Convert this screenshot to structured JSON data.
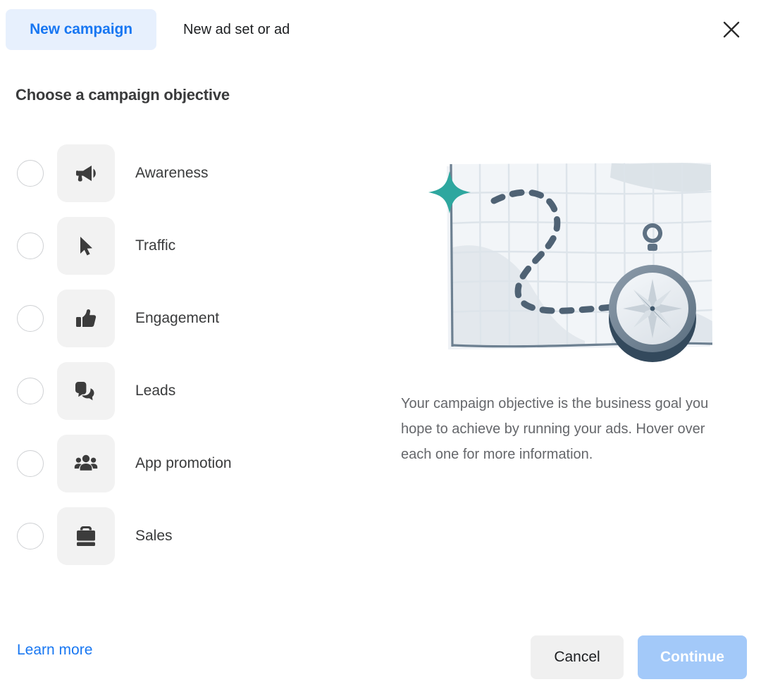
{
  "header": {
    "tabs": [
      {
        "label": "New campaign",
        "active": true,
        "name": "tab-new-campaign"
      },
      {
        "label": "New ad set or ad",
        "active": false,
        "name": "tab-new-ad-set-or-ad"
      }
    ],
    "close_icon": "close-icon",
    "accent_color": "#1877f2",
    "active_tab_bg": "#e7f0fd"
  },
  "main": {
    "section_title": "Choose a campaign objective",
    "objectives": [
      {
        "label": "Awareness",
        "icon": "megaphone-icon",
        "selected": false
      },
      {
        "label": "Traffic",
        "icon": "cursor-icon",
        "selected": false
      },
      {
        "label": "Engagement",
        "icon": "thumbs-up-icon",
        "selected": false
      },
      {
        "label": "Leads",
        "icon": "chat-bubbles-icon",
        "selected": false
      },
      {
        "label": "App promotion",
        "icon": "people-group-icon",
        "selected": false
      },
      {
        "label": "Sales",
        "icon": "briefcase-icon",
        "selected": false
      }
    ]
  },
  "info_panel": {
    "illustration_name": "map-with-compass-illustration",
    "star_color": "#2ea79f",
    "path_color": "#4f6274",
    "description": "Your campaign objective is the business goal you hope to achieve by running your ads. Hover over each one for more information."
  },
  "footer": {
    "learn_more_label": "Learn more",
    "cancel_label": "Cancel",
    "continue_label": "Continue",
    "continue_disabled": true,
    "continue_bg": "#a3c9f9",
    "cancel_bg": "#f0f0f0"
  }
}
